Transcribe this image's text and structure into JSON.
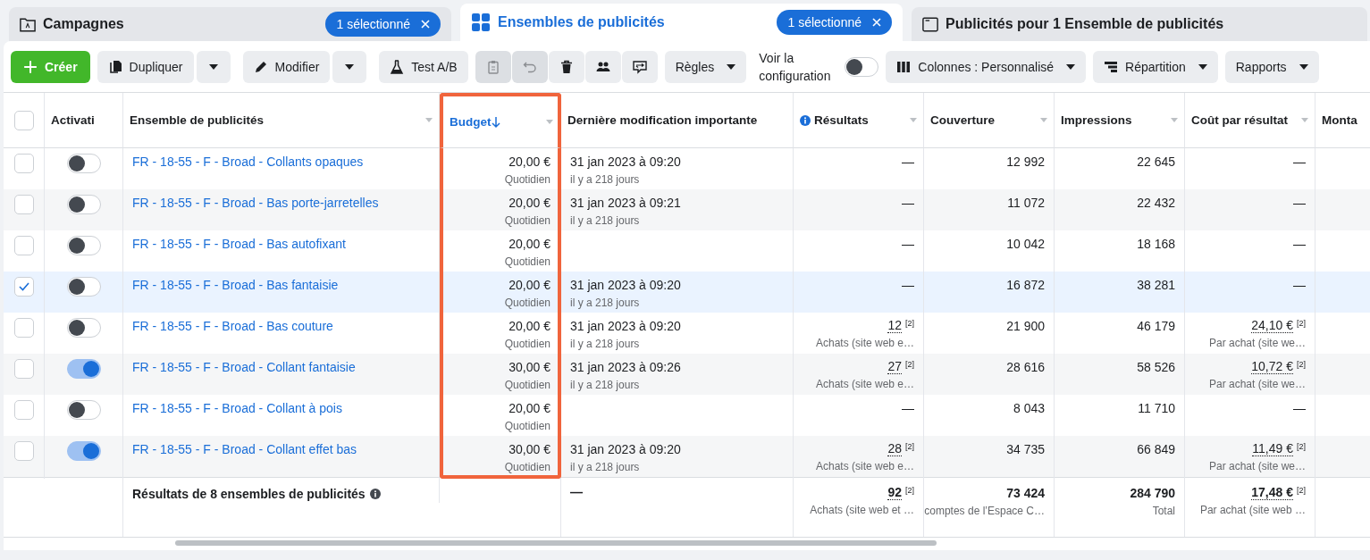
{
  "tabs": [
    {
      "kind": "campaign",
      "label": "Campagnes",
      "badge": "1 sélectionné",
      "selected": false
    },
    {
      "kind": "adset",
      "label": "Ensembles de publicités",
      "badge": "1 sélectionné",
      "selected": true
    },
    {
      "kind": "ad",
      "label": "Publicités pour 1 Ensemble de publicités",
      "selected": false
    }
  ],
  "toolbar": {
    "create": "Créer",
    "duplicate": "Dupliquer",
    "edit": "Modifier",
    "ab_test": "Test A/B",
    "icon_buttons": [
      {
        "disabled": true
      },
      {
        "disabled": true
      },
      {
        "disabled": false
      },
      {
        "disabled": false
      },
      {
        "disabled": false
      }
    ],
    "rules": "Règles",
    "config_toggle": {
      "label": "Voir la configuration",
      "on": false
    },
    "columns": "Colonnes : Personnalisé",
    "breakdown": "Répartition",
    "reports": "Rapports"
  },
  "table": {
    "select_all": {
      "checked": false
    },
    "columns": [
      {
        "label": "Activati",
        "menu": false,
        "info": false,
        "sorted": false,
        "highlighted": false
      },
      {
        "label": "Ensemble de publicités",
        "menu": true,
        "info": false,
        "sorted": false,
        "highlighted": false
      },
      {
        "label": "Budget",
        "menu": true,
        "info": false,
        "sorted": true,
        "highlighted": true
      },
      {
        "label": "Dernière modification importante",
        "menu": false,
        "info": false,
        "sorted": false,
        "highlighted": false
      },
      {
        "label": "Résultats",
        "menu": true,
        "info": true,
        "sorted": false,
        "highlighted": false
      },
      {
        "label": "Couverture",
        "menu": true,
        "info": false,
        "sorted": false,
        "highlighted": false
      },
      {
        "label": "Impressions",
        "menu": true,
        "info": false,
        "sorted": false,
        "highlighted": false
      },
      {
        "label": "Coût par résultat",
        "menu": true,
        "info": false,
        "sorted": false,
        "highlighted": false
      },
      {
        "label": "Monta",
        "menu": false,
        "info": false,
        "sorted": false,
        "highlighted": false
      }
    ],
    "rows": [
      {
        "selected": false,
        "on": false,
        "name": "FR - 18-55 - F - Broad - Collants opaques",
        "budget": "20,00 €",
        "budget_type": "Quotidien",
        "modified": "31 jan 2023 à 09:20",
        "modified_ago": "il y a 218 jours",
        "results": "—",
        "reach": "12 992",
        "impressions": "22 645",
        "cost": "—"
      },
      {
        "selected": false,
        "on": false,
        "name": "FR - 18-55 - F - Broad - Bas porte-jarretelles",
        "budget": "20,00 €",
        "budget_type": "Quotidien",
        "modified": "31 jan 2023 à 09:21",
        "modified_ago": "il y a 218 jours",
        "results": "—",
        "reach": "11 072",
        "impressions": "22 432",
        "cost": "—"
      },
      {
        "selected": false,
        "on": false,
        "name": "FR - 18-55 - F - Broad - Bas autofixant",
        "budget": "20,00 €",
        "budget_type": "Quotidien",
        "results": "—",
        "reach": "10 042",
        "impressions": "18 168",
        "cost": "—"
      },
      {
        "selected": true,
        "on": false,
        "name": "FR - 18-55 - F - Broad - Bas fantaisie",
        "budget": "20,00 €",
        "budget_type": "Quotidien",
        "modified": "31 jan 2023 à 09:20",
        "modified_ago": "il y a 218 jours",
        "results": "—",
        "reach": "16 872",
        "impressions": "38 281",
        "cost": "—"
      },
      {
        "selected": false,
        "on": false,
        "name": "FR - 18-55 - F - Broad - Bas couture",
        "budget": "20,00 €",
        "budget_type": "Quotidien",
        "modified": "31 jan 2023 à 09:20",
        "modified_ago": "il y a 218 jours",
        "results": "12",
        "results_ref": "[2]",
        "results_note": "Achats (site web e…",
        "reach": "21 900",
        "impressions": "46 179",
        "cost": "24,10 €",
        "cost_ref": "[2]",
        "cost_note": "Par achat (site we…"
      },
      {
        "selected": false,
        "on": true,
        "name": "FR - 18-55 - F - Broad - Collant fantaisie",
        "budget": "30,00 €",
        "budget_type": "Quotidien",
        "modified": "31 jan 2023 à 09:26",
        "modified_ago": "il y a 218 jours",
        "results": "27",
        "results_ref": "[2]",
        "results_note": "Achats (site web e…",
        "reach": "28 616",
        "impressions": "58 526",
        "cost": "10,72 €",
        "cost_ref": "[2]",
        "cost_note": "Par achat (site we…"
      },
      {
        "selected": false,
        "on": false,
        "name": "FR - 18-55 - F - Broad - Collant à pois",
        "budget": "20,00 €",
        "budget_type": "Quotidien",
        "results": "—",
        "reach": "8 043",
        "impressions": "11 710",
        "cost": "—"
      },
      {
        "selected": false,
        "on": true,
        "name": "FR - 18-55 - F - Broad - Collant effet bas",
        "budget": "30,00 €",
        "budget_type": "Quotidien",
        "modified": "31 jan 2023 à 09:20",
        "modified_ago": "il y a 218 jours",
        "results": "28",
        "results_ref": "[2]",
        "results_note": "Achats (site web e…",
        "reach": "34 735",
        "impressions": "66 849",
        "cost": "11,49 €",
        "cost_ref": "[2]",
        "cost_note": "Par achat (site we…"
      }
    ],
    "footer": {
      "label": "Résultats de 8 ensembles de publicités",
      "modified": "—",
      "results": {
        "value": "92",
        "ref": "[2]",
        "note": "Achats (site web et …"
      },
      "reach": {
        "value": "73 424",
        "note": "comptes de l’Espace C…"
      },
      "impressions": {
        "value": "284 790",
        "note": "Total"
      },
      "cost": {
        "value": "17,48 €",
        "ref": "[2]",
        "note": "Par achat (site web …"
      }
    }
  }
}
